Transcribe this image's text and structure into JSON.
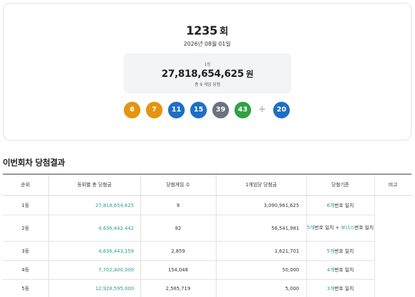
{
  "draw": {
    "round": "1235",
    "round_suffix": "회",
    "date": "2026년 08월 01일"
  },
  "first_prize": {
    "rank_label": "1등",
    "amount": "27,818,654,625",
    "unit": "원",
    "winners_text": "총 9 게임 당첨"
  },
  "numbers": [
    {
      "value": "6",
      "color": "#e5940f"
    },
    {
      "value": "7",
      "color": "#e5940f"
    },
    {
      "value": "11",
      "color": "#1e6fc4"
    },
    {
      "value": "15",
      "color": "#1e6fc4"
    },
    {
      "value": "39",
      "color": "#6b7280"
    },
    {
      "value": "43",
      "color": "#31a046"
    }
  ],
  "plus": "+",
  "bonus": {
    "value": "20",
    "color": "#1e6fc4"
  },
  "section_title": "이번회차 당첨결과",
  "table": {
    "headers": [
      "순위",
      "등위별 총 당첨금",
      "당첨게임 수",
      "1게임당 당첨금",
      "당첨기준",
      "비고"
    ],
    "rows": [
      {
        "rank": "1등",
        "total": "27,818,654,625",
        "games": "9",
        "per_game": "3,090,961,625",
        "criteria_count": "6개",
        "criteria_text": "번호 일치"
      },
      {
        "rank": "2등",
        "total": "4,636,442,442",
        "games": "82",
        "per_game": "56,541,981",
        "criteria_count": "5개",
        "criteria_text": "번호 일치 +",
        "criteria_bonus": "보너스",
        "criteria_tail": "번호 일치"
      },
      {
        "rank": "3등",
        "total": "4,636,443,159",
        "games": "2,859",
        "per_game": "1,621,701",
        "criteria_count": "5개",
        "criteria_text": "번호 일치"
      },
      {
        "rank": "4등",
        "total": "7,702,400,000",
        "games": "154,048",
        "per_game": "50,000",
        "criteria_count": "4개",
        "criteria_text": "번호 일치"
      },
      {
        "rank": "5등",
        "total": "12,928,595,000",
        "games": "2,585,719",
        "per_game": "5,000",
        "criteria_count": "3개",
        "criteria_text": "번호 일치"
      }
    ]
  },
  "colors": {
    "accent_green": "#2a9d8f",
    "ball_yellow": "#e5940f",
    "ball_blue": "#1e6fc4",
    "ball_gray": "#6b7280",
    "ball_green": "#31a046"
  }
}
